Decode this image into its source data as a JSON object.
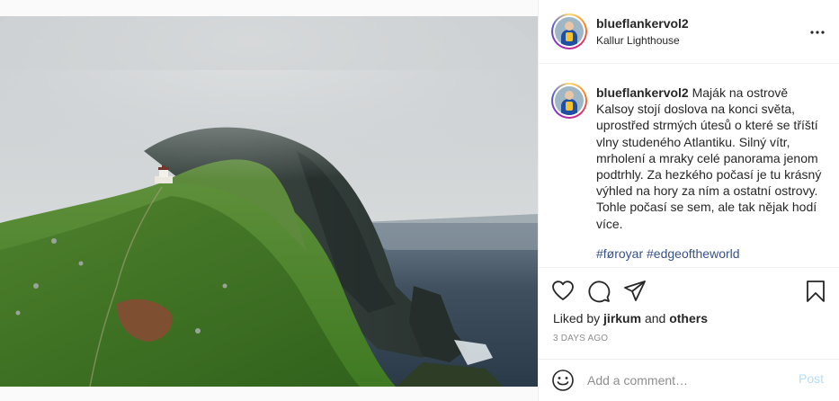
{
  "post": {
    "photo_alt": "Kallur Lighthouse on Kalsoy island with misty cliffs",
    "username": "blueflankervol2",
    "location": "Kallur Lighthouse",
    "caption_text": " Maják na ostrově Kalsoy stojí doslova na konci světa, uprostřed strmých útesů o které se tříští vlny studeného Atlantiku. Silný vítr, mrholení a mraky celé panorama jenom podtrhly. Za hezkého počasí je tu krásný výhled na hory za ním a ostatní ostrovy. Tohle počasí se sem, ale tak nějak hodí více.",
    "hashtags": "#føroyar #edgeoftheworld",
    "liked_by_prefix": "Liked by ",
    "liked_by_user": "jirkum",
    "liked_by_middle": " and ",
    "liked_by_others": "others",
    "date": "3 DAYS AGO"
  },
  "actions": {
    "like_icon": "heart-icon",
    "comment_icon": "comment-icon",
    "share_icon": "paper-plane-icon",
    "save_icon": "bookmark-icon"
  },
  "comment": {
    "placeholder": "Add a comment…",
    "post_label": "Post",
    "emoji_icon": "smiley-icon"
  },
  "colors": {
    "link": "#385185",
    "post_disabled": "#b2dffc",
    "muted": "#8e8e8e"
  }
}
